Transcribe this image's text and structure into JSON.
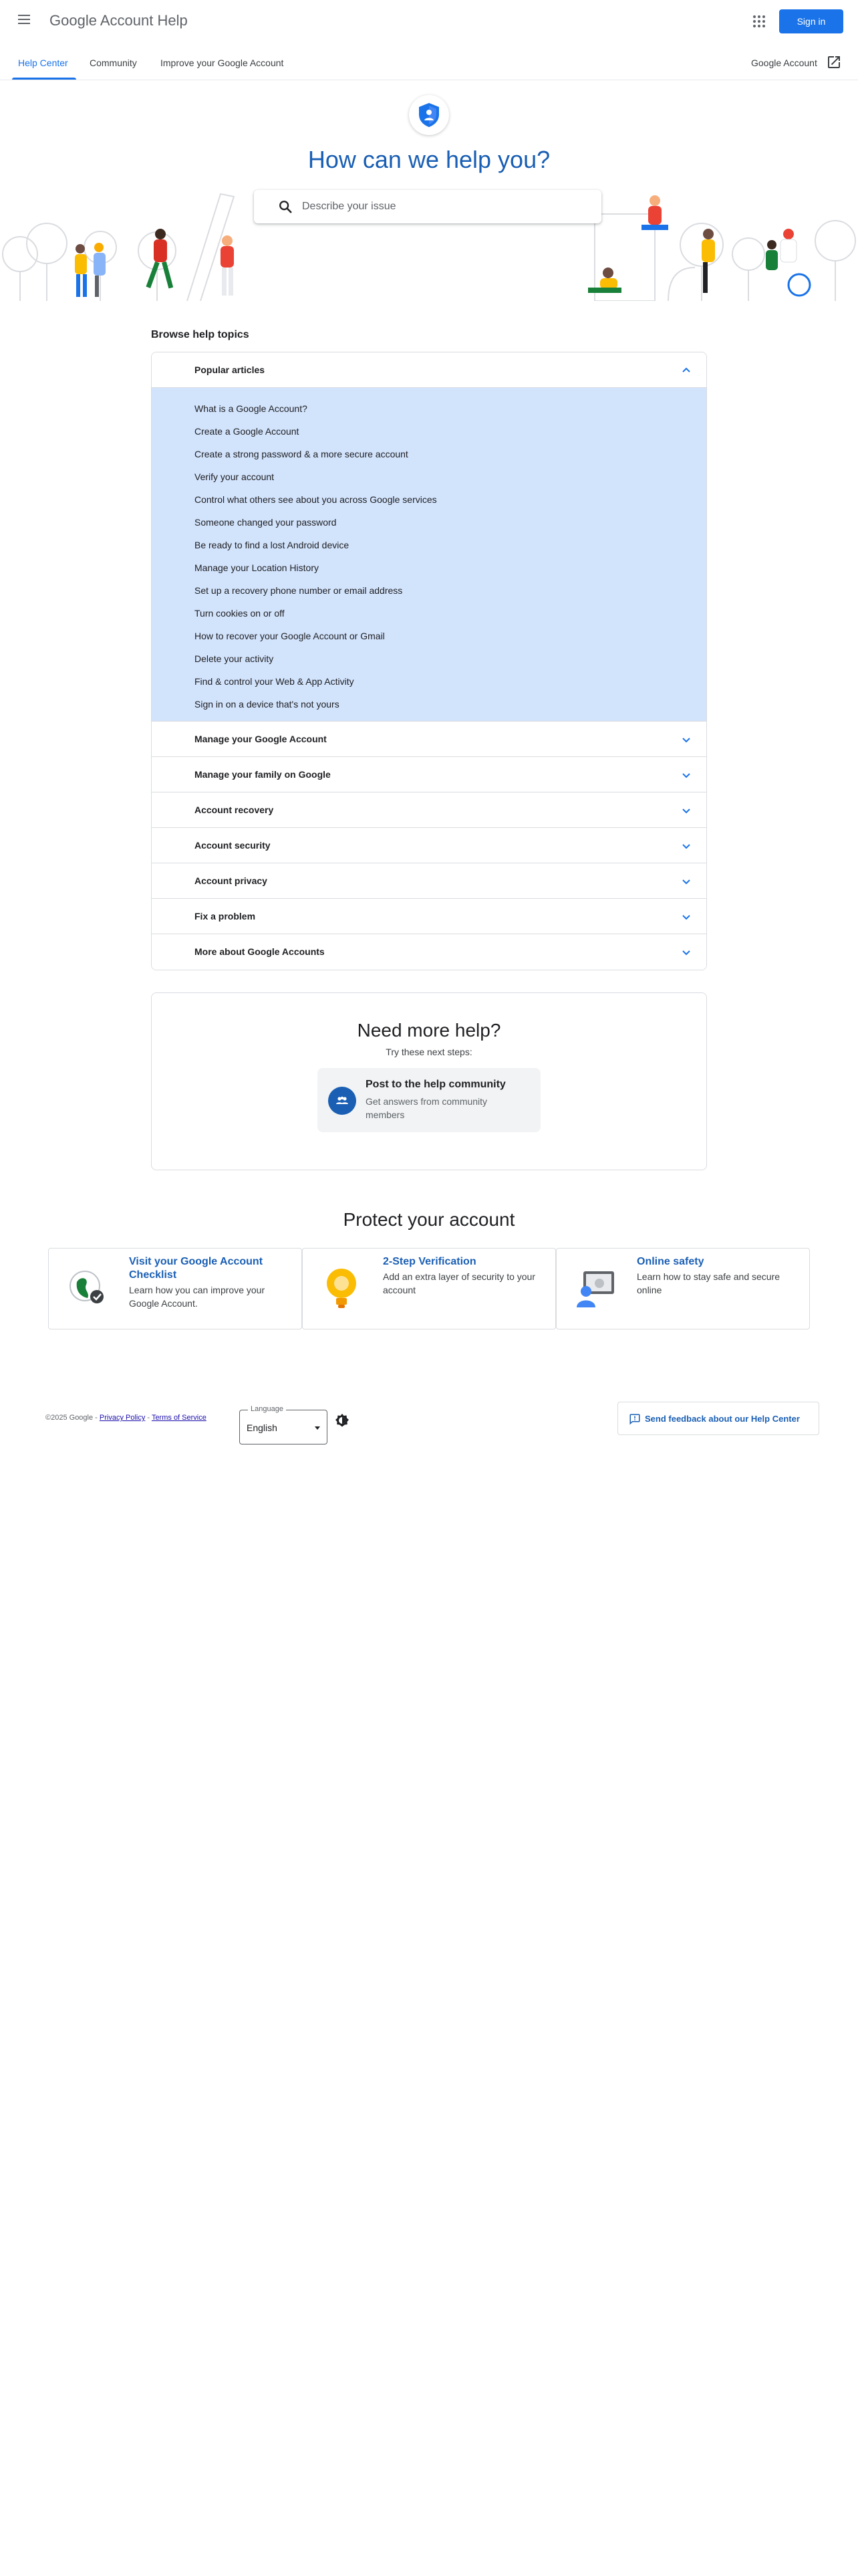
{
  "header": {
    "app_title": "Google Account Help",
    "sign_in_label": "Sign in",
    "icons": [
      "menu-icon",
      "apps-grid-icon"
    ]
  },
  "tabs": {
    "items": [
      {
        "label": "Help Center",
        "active": true
      },
      {
        "label": "Community",
        "active": false
      },
      {
        "label": "Improve your Google Account",
        "active": false
      }
    ],
    "account_link": "Google Account",
    "account_link_icon": "open-in-new-icon"
  },
  "hero": {
    "title": "How can we help you?",
    "search_placeholder": "Describe your issue",
    "icons": [
      "shield-logo-icon",
      "search-icon"
    ]
  },
  "browse": {
    "title": "Browse help topics",
    "popular": {
      "label": "Popular articles",
      "expanded": true,
      "articles": [
        "What is a Google Account?",
        "Create a Google Account",
        "Create a strong password & a more secure account",
        "Verify your account",
        "Control what others see about you across Google services",
        "Someone changed your password",
        "Be ready to find a lost Android device",
        "Manage your Location History",
        "Set up a recovery phone number or email address",
        "Turn cookies on or off",
        "How to recover your Google Account or Gmail",
        "Delete your activity",
        "Find & control your Web & App Activity",
        "Sign in on a device that's not yours"
      ]
    },
    "topics": [
      "Manage your Google Account",
      "Manage your family on Google",
      "Account recovery",
      "Account security",
      "Account privacy",
      "Fix a problem",
      "More about Google Accounts"
    ]
  },
  "more_help": {
    "title": "Need more help?",
    "subtitle": "Try these next steps:",
    "card_title": "Post to the help community",
    "card_desc": "Get answers from community members",
    "card_icon": "community-people-icon"
  },
  "protect": {
    "title": "Protect your account",
    "cards": [
      {
        "title": "Visit your Google Account Checklist",
        "desc": "Learn how you can improve your Google Account.",
        "icon": "checklist-globe-icon"
      },
      {
        "title": "2-Step Verification",
        "desc": "Add an extra layer of security to your account",
        "icon": "lightbulb-icon"
      },
      {
        "title": "Online safety",
        "desc": "Learn how to stay safe and secure online",
        "icon": "online-safety-icon"
      }
    ]
  },
  "footer": {
    "copyright": "©2025 Google - ",
    "privacy": "Privacy Policy",
    "separator": " - ",
    "terms": "Terms of Service",
    "language_label": "Language",
    "language_value": "English",
    "feedback_label": "Send feedback about our Help Center",
    "icons": [
      "theme-toggle-icon",
      "feedback-icon"
    ]
  },
  "colors": {
    "accent": "#1a73e8",
    "title_blue": "#1a5fb4",
    "expanded_bg": "#d2e3fc"
  }
}
